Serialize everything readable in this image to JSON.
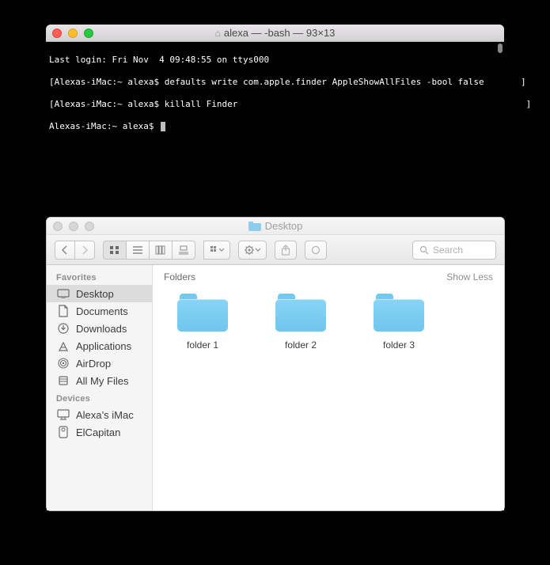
{
  "terminal": {
    "title": "alexa — -bash — 93×13",
    "lines": [
      "Last login: Fri Nov  4 09:48:55 on ttys000",
      "[Alexas-iMac:~ alexa$ defaults write com.apple.finder AppleShowAllFiles -bool false       ]",
      "[Alexas-iMac:~ alexa$ killall Finder                                                       ]",
      "Alexas-iMac:~ alexa$ "
    ]
  },
  "finder": {
    "title": "Desktop",
    "search_placeholder": "Search",
    "sidebar": {
      "sections": [
        {
          "header": "Favorites",
          "items": [
            {
              "label": "Desktop",
              "icon": "desktop",
              "active": true
            },
            {
              "label": "Documents",
              "icon": "documents",
              "active": false
            },
            {
              "label": "Downloads",
              "icon": "downloads",
              "active": false
            },
            {
              "label": "Applications",
              "icon": "applications",
              "active": false
            },
            {
              "label": "AirDrop",
              "icon": "airdrop",
              "active": false
            },
            {
              "label": "All My Files",
              "icon": "allmyfiles",
              "active": false
            }
          ]
        },
        {
          "header": "Devices",
          "items": [
            {
              "label": "Alexa’s iMac",
              "icon": "imac",
              "active": false
            },
            {
              "label": "ElCapitan",
              "icon": "disk",
              "active": false
            }
          ]
        }
      ]
    },
    "content": {
      "section_title": "Folders",
      "section_action": "Show Less",
      "items": [
        {
          "label": "folder 1"
        },
        {
          "label": "folder 2"
        },
        {
          "label": "folder 3"
        }
      ]
    }
  }
}
